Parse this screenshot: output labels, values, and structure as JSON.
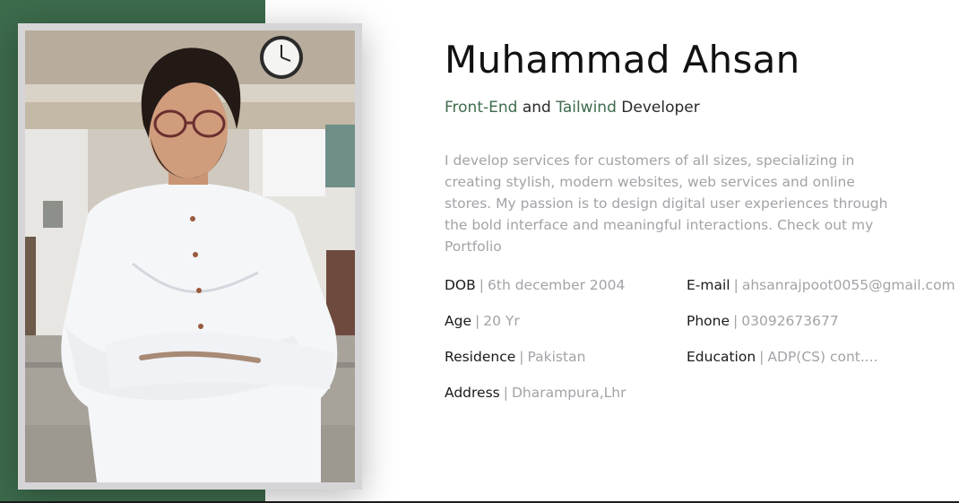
{
  "profile": {
    "name": "Muhammad Ahsan",
    "role": {
      "part1": "Front-End",
      "connector": "and",
      "part2": "Tailwind",
      "part3": "Developer"
    },
    "bio": "I develop services for customers of all sizes, specializing in creating stylish, modern websites, web services and online stores. My passion is to design digital user experiences through the bold interface and meaningful interactions. Check out my Portfolio"
  },
  "info": {
    "separator": "|",
    "left": [
      {
        "label": "DOB",
        "value": "6th december 2004"
      },
      {
        "label": "Age",
        "value": "20 Yr"
      },
      {
        "label": "Residence",
        "value": "Pakistan"
      },
      {
        "label": "Address",
        "value": "Dharampura,Lhr"
      }
    ],
    "right": [
      {
        "label": "E-mail",
        "value": "ahsanrajpoot0055@gmail.com"
      },
      {
        "label": "Phone",
        "value": "03092673677"
      },
      {
        "label": "Education",
        "value": "ADP(CS) cont...."
      }
    ]
  },
  "colors": {
    "accent": "#3d6b4c",
    "muted_text": "#a3a3a8",
    "frame": "#d5d5d8"
  }
}
